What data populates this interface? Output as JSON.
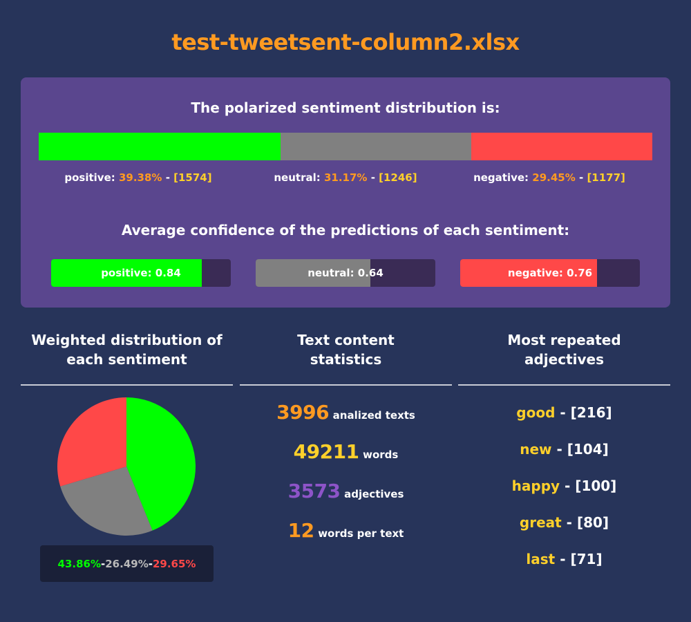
{
  "title": "test-tweetsent-column2.xlsx",
  "colors": {
    "positive": "#00ff00",
    "neutral": "#808080",
    "negative": "#ff4848",
    "orange": "#ff9a21",
    "yellow": "#ffd02a",
    "purple": "#8d54c8"
  },
  "polarized": {
    "heading": "The polarized sentiment distribution is:",
    "items": [
      {
        "name": "positive",
        "label": "positive:",
        "percent": "39.38%",
        "count": "[1574]",
        "fraction": 0.3938
      },
      {
        "name": "neutral",
        "label": "neutral:",
        "percent": "31.17%",
        "count": "[1246]",
        "fraction": 0.3117
      },
      {
        "name": "negative",
        "label": "negative:",
        "percent": "29.45%",
        "count": "[1177]",
        "fraction": 0.2945
      }
    ]
  },
  "confidence": {
    "heading": "Average confidence of the predictions of each sentiment:",
    "items": [
      {
        "name": "positive",
        "text": "positive: 0.84",
        "value": 0.84
      },
      {
        "name": "neutral",
        "text": "neutral: 0.64",
        "value": 0.64
      },
      {
        "name": "negative",
        "text": "negative: 0.76",
        "value": 0.76
      }
    ]
  },
  "columns": {
    "weighted": {
      "line1": "Weighted distribution of",
      "line2": "each sentiment"
    },
    "stats": {
      "line1": "Text content",
      "line2": "statistics"
    },
    "adjectives": {
      "line1": "Most repeated",
      "line2": "adjectives"
    }
  },
  "chart_data": {
    "type": "pie",
    "categories": [
      "positive",
      "neutral",
      "negative"
    ],
    "values": [
      43.86,
      26.49,
      29.65
    ],
    "labels": [
      "43.86%",
      "26.49%",
      "29.65%"
    ],
    "separator": "-",
    "colors": [
      "#00ff00",
      "#808080",
      "#ff4848"
    ]
  },
  "stats": [
    {
      "value": "3996",
      "label": "analized texts",
      "color": "#ff9a21"
    },
    {
      "value": "49211",
      "label": "words",
      "color": "#ffd02a"
    },
    {
      "value": "3573",
      "label": "adjectives",
      "color": "#8d54c8"
    },
    {
      "value": "12",
      "label": "words per text",
      "color": "#ff9a21"
    }
  ],
  "adjectives": [
    {
      "word": "good",
      "count": "[216]"
    },
    {
      "word": "new",
      "count": "[104]"
    },
    {
      "word": "happy",
      "count": "[100]"
    },
    {
      "word": "great",
      "count": "[80]"
    },
    {
      "word": "last",
      "count": "[71]"
    }
  ],
  "separator": " - "
}
